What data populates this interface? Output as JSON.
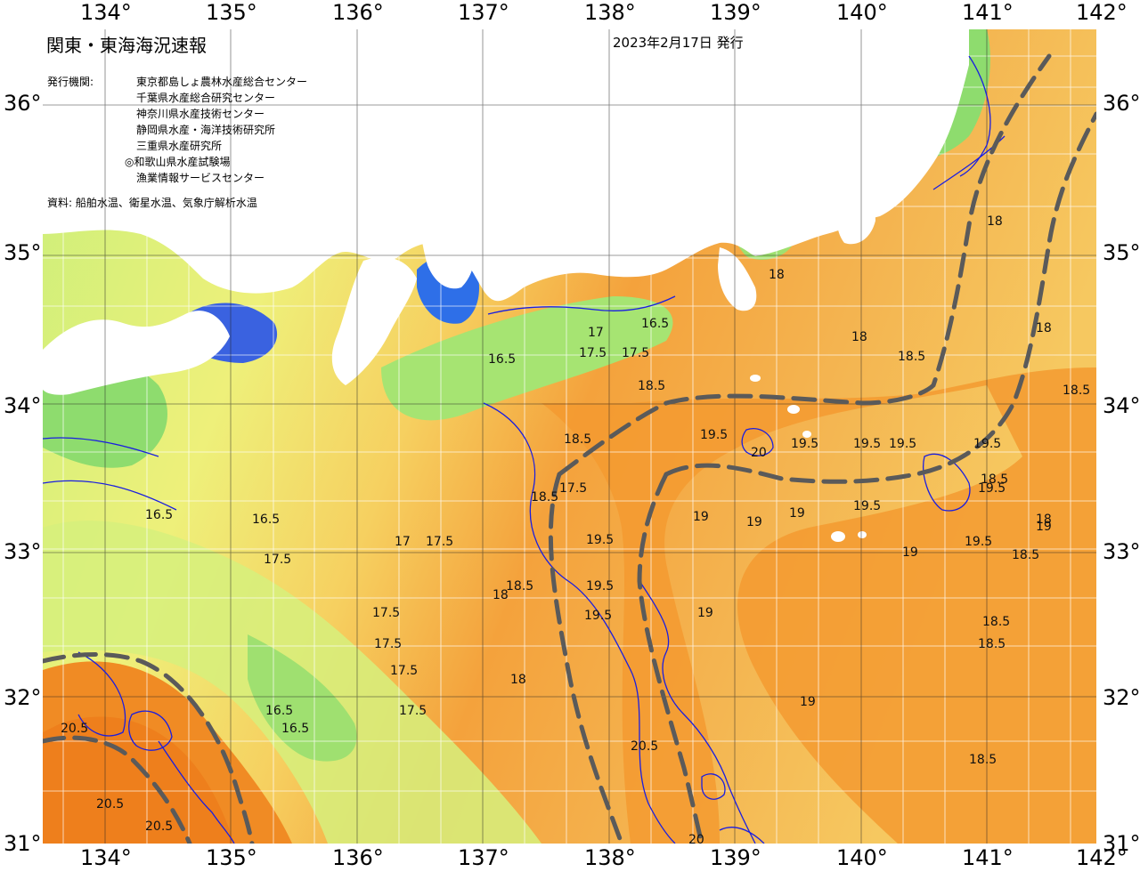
{
  "title": "関東・東海海況速報",
  "issue_date": "2023年2月17日 発行",
  "issuer_label": "発行機関:",
  "issuers": [
    "東京都島しょ農林水産総合センター",
    "千葉県水産総合研究センター",
    "神奈川県水産技術センター",
    "静岡県水産・海洋技術研究所",
    "三重県水産研究所",
    "◎和歌山県水産試験場",
    "漁業情報サービスセンター"
  ],
  "source_line": "資料: 船舶水温、衛星水温、気象庁解析水温",
  "longitudes": [
    "134°",
    "135°",
    "136°",
    "137°",
    "138°",
    "139°",
    "140°",
    "141°",
    "142°"
  ],
  "latitudes": [
    "36°",
    "35°",
    "34°",
    "33°",
    "32°",
    "31°"
  ],
  "colors": {
    "land": "#ffffff",
    "sst_16": "#7fd86e",
    "sst_17": "#c8ef7a",
    "sst_18": "#f6e06a",
    "sst_19": "#f4b14a",
    "sst_20": "#f08b24",
    "cold_13": "#2e6fe8",
    "cold_14": "#8adfe6",
    "isotherm": "#1a1ee0",
    "kuroshio_axis": "#555555"
  },
  "isotherm_labels": [
    {
      "t": "16.5"
    },
    {
      "t": "16.5"
    },
    {
      "t": "16.5"
    },
    {
      "t": "16.5"
    },
    {
      "t": "16.5"
    },
    {
      "t": "16.5"
    },
    {
      "t": "17"
    },
    {
      "t": "17"
    },
    {
      "t": "17.5"
    },
    {
      "t": "17.5"
    },
    {
      "t": "17.5"
    },
    {
      "t": "17.5"
    },
    {
      "t": "17.5"
    },
    {
      "t": "17.5"
    },
    {
      "t": "17.5"
    },
    {
      "t": "17.5"
    },
    {
      "t": "17.5"
    },
    {
      "t": "18"
    },
    {
      "t": "18"
    },
    {
      "t": "18"
    },
    {
      "t": "18"
    },
    {
      "t": "18"
    },
    {
      "t": "18"
    },
    {
      "t": "18"
    },
    {
      "t": "18.5"
    },
    {
      "t": "18.5"
    },
    {
      "t": "18.5"
    },
    {
      "t": "18.5"
    },
    {
      "t": "18.5"
    },
    {
      "t": "18.5"
    },
    {
      "t": "18.5"
    },
    {
      "t": "18.5"
    },
    {
      "t": "18.5"
    },
    {
      "t": "18.5"
    },
    {
      "t": "18.5"
    },
    {
      "t": "19"
    },
    {
      "t": "19"
    },
    {
      "t": "19"
    },
    {
      "t": "19"
    },
    {
      "t": "19"
    },
    {
      "t": "19"
    },
    {
      "t": "19"
    },
    {
      "t": "19.5"
    },
    {
      "t": "19.5"
    },
    {
      "t": "19.5"
    },
    {
      "t": "19.5"
    },
    {
      "t": "19.5"
    },
    {
      "t": "19.5"
    },
    {
      "t": "19.5"
    },
    {
      "t": "19.5"
    },
    {
      "t": "19.5"
    },
    {
      "t": "19.5"
    },
    {
      "t": "19.5"
    },
    {
      "t": "20"
    },
    {
      "t": "20"
    },
    {
      "t": "20.5"
    },
    {
      "t": "20.5"
    },
    {
      "t": "20.5"
    },
    {
      "t": "20.5"
    }
  ]
}
